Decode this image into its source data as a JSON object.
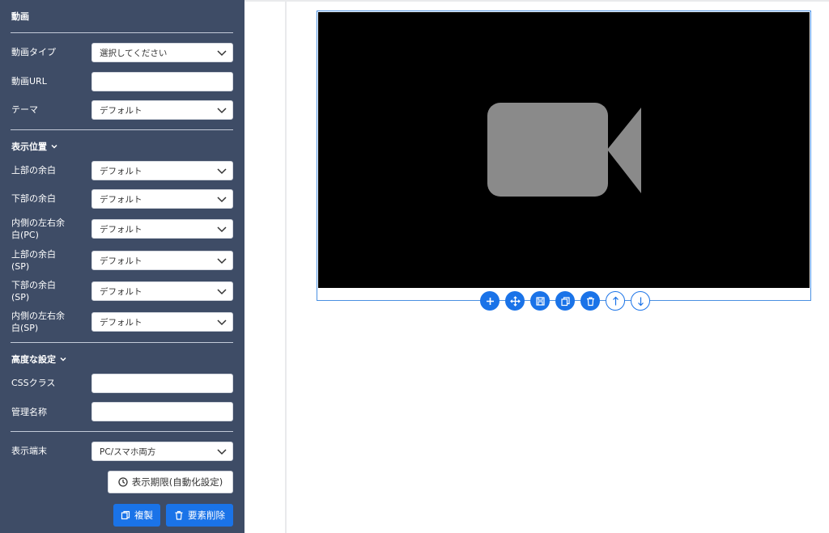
{
  "panel": {
    "title": "動画",
    "fields": {
      "video_type": {
        "label": "動画タイプ",
        "value": "選択してください"
      },
      "video_url": {
        "label": "動画URL",
        "value": ""
      },
      "theme": {
        "label": "テーマ",
        "value": "デフォルト"
      }
    },
    "position_section": {
      "title": "表示位置",
      "top_margin": {
        "label": "上部の余白",
        "value": "デフォルト"
      },
      "bottom_margin": {
        "label": "下部の余白",
        "value": "デフォルト"
      },
      "inner_lr_pc": {
        "label_line1": "内側の左右余",
        "label_line2": "白(PC)",
        "value": "デフォルト"
      },
      "top_margin_sp": {
        "label_line1": "上部の余白",
        "label_line2": "(SP)",
        "value": "デフォルト"
      },
      "bottom_margin_sp": {
        "label_line1": "下部の余白",
        "label_line2": "(SP)",
        "value": "デフォルト"
      },
      "inner_lr_sp": {
        "label_line1": "内側の左右余",
        "label_line2": "白(SP)",
        "value": "デフォルト"
      }
    },
    "advanced_section": {
      "title": "高度な設定",
      "css_class": {
        "label": "CSSクラス",
        "value": ""
      },
      "admin_name": {
        "label": "管理名称",
        "value": ""
      }
    },
    "device": {
      "label": "表示端末",
      "value": "PC/スマホ両方"
    },
    "buttons": {
      "schedule": "表示期限(自動化設定)",
      "duplicate": "複製",
      "delete": "要素削除"
    }
  },
  "toolbar_icons": [
    "plus-icon",
    "move-icon",
    "save-icon",
    "copy-icon",
    "trash-icon",
    "arrow-up-icon",
    "arrow-down-icon"
  ],
  "colors": {
    "sidebar_bg": "#3e4c66",
    "accent": "#1a73e8",
    "video_bg": "#000000",
    "video_icon": "#8a8a8a"
  }
}
